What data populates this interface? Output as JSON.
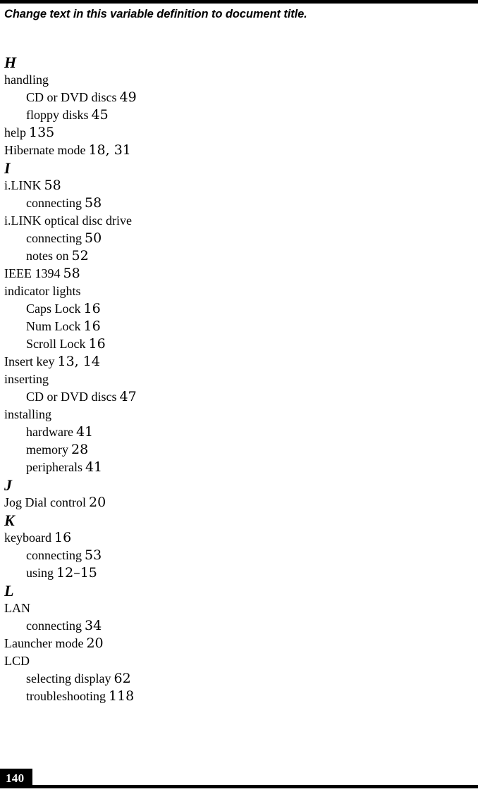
{
  "header": {
    "note": "Change text in this variable definition to document title."
  },
  "index": {
    "sections": [
      {
        "letter": "H",
        "entries": [
          {
            "label": "handling",
            "pages": "",
            "level": 0
          },
          {
            "label": "CD or DVD discs",
            "pages": "49",
            "level": 1
          },
          {
            "label": "floppy disks",
            "pages": "45",
            "level": 1
          },
          {
            "label": "help",
            "pages": "135",
            "level": 0
          },
          {
            "label": "Hibernate mode",
            "pages": "18, 31",
            "level": 0
          }
        ]
      },
      {
        "letter": "I",
        "entries": [
          {
            "label": "i.LINK",
            "pages": "58",
            "level": 0
          },
          {
            "label": "connecting",
            "pages": "58",
            "level": 1
          },
          {
            "label": "i.LINK optical disc drive",
            "pages": "",
            "level": 0
          },
          {
            "label": "connecting",
            "pages": "50",
            "level": 1
          },
          {
            "label": "notes on",
            "pages": "52",
            "level": 1
          },
          {
            "label": "IEEE 1394",
            "pages": "58",
            "level": 0
          },
          {
            "label": "indicator lights",
            "pages": "",
            "level": 0
          },
          {
            "label": "Caps Lock",
            "pages": "16",
            "level": 1
          },
          {
            "label": "Num Lock",
            "pages": "16",
            "level": 1
          },
          {
            "label": "Scroll Lock",
            "pages": "16",
            "level": 1
          },
          {
            "label": "Insert key",
            "pages": "13, 14",
            "level": 0
          },
          {
            "label": "inserting",
            "pages": "",
            "level": 0
          },
          {
            "label": "CD or DVD discs",
            "pages": "47",
            "level": 1
          },
          {
            "label": "installing",
            "pages": "",
            "level": 0
          },
          {
            "label": "hardware",
            "pages": "41",
            "level": 1
          },
          {
            "label": "memory",
            "pages": "28",
            "level": 1
          },
          {
            "label": "peripherals",
            "pages": "41",
            "level": 1
          }
        ]
      },
      {
        "letter": "J",
        "entries": [
          {
            "label": "Jog Dial control",
            "pages": "20",
            "level": 0
          }
        ]
      },
      {
        "letter": "K",
        "entries": [
          {
            "label": "keyboard",
            "pages": "16",
            "level": 0
          },
          {
            "label": "connecting",
            "pages": "53",
            "level": 1
          },
          {
            "label": "using",
            "pages": "12–15",
            "level": 1
          }
        ]
      },
      {
        "letter": "L",
        "entries": [
          {
            "label": "LAN",
            "pages": "",
            "level": 0
          },
          {
            "label": "connecting",
            "pages": "34",
            "level": 1
          },
          {
            "label": "Launcher mode",
            "pages": "20",
            "level": 0
          },
          {
            "label": "LCD",
            "pages": "",
            "level": 0
          },
          {
            "label": "selecting display",
            "pages": "62",
            "level": 1
          },
          {
            "label": "troubleshooting",
            "pages": "118",
            "level": 1
          }
        ]
      }
    ]
  },
  "footer": {
    "page_number": "140"
  }
}
